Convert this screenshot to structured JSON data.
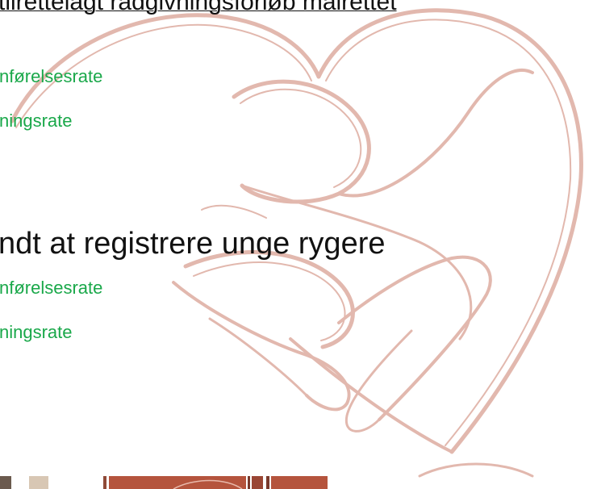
{
  "slide": {
    "top_heading": "tilrettelagt rådgivningsforløb målrettet",
    "section1": {
      "line1": "nførelsesrate",
      "line2": "ningsrate"
    },
    "main_heading": "ndt at registrere unge rygere",
    "section2": {
      "line1": "nførelsesrate",
      "line2": "ningsrate"
    }
  },
  "colors": {
    "accent_green": "#1aa84a",
    "heart_stroke": "#d9a193",
    "footer_brown": "#b5543d"
  },
  "icons": {
    "background": "heart-hands-illustration"
  }
}
